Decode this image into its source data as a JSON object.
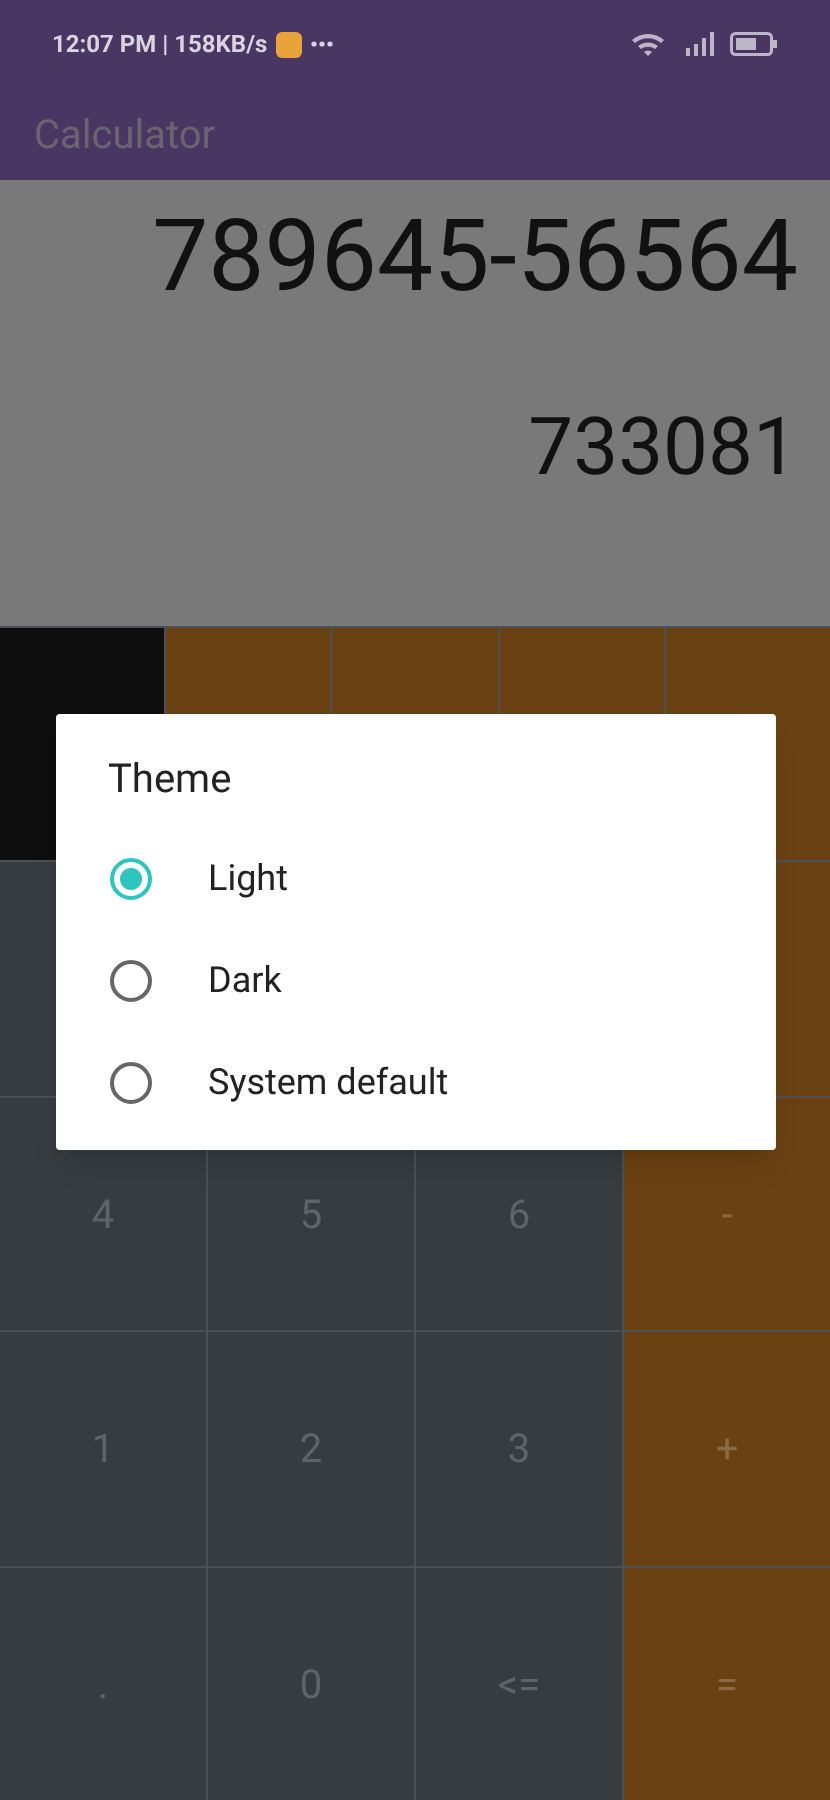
{
  "status_bar": {
    "time": "12:07 PM | 158KB/s"
  },
  "app_bar": {
    "title": "Calculator"
  },
  "display": {
    "expression": "789645-56564",
    "result": "733081"
  },
  "keypad": {
    "rows": [
      [
        {
          "kind": "function"
        },
        {
          "kind": "operator"
        },
        {
          "kind": "operator"
        },
        {
          "kind": "operator"
        },
        {
          "kind": "operator"
        }
      ],
      [
        {
          "kind": "digit"
        },
        {
          "kind": "digit"
        },
        {
          "kind": "digit"
        },
        {
          "kind": "operator"
        }
      ],
      [
        {
          "kind": "digit",
          "label": "4"
        },
        {
          "kind": "digit",
          "label": "5"
        },
        {
          "kind": "digit",
          "label": "6"
        },
        {
          "kind": "operator",
          "label": "-"
        }
      ],
      [
        {
          "kind": "digit",
          "label": "1"
        },
        {
          "kind": "digit",
          "label": "2"
        },
        {
          "kind": "digit",
          "label": "3"
        },
        {
          "kind": "operator",
          "label": "+"
        }
      ],
      [
        {
          "kind": "digit",
          "label": "."
        },
        {
          "kind": "digit",
          "label": "0"
        },
        {
          "kind": "digit",
          "label": "<="
        },
        {
          "kind": "operator",
          "label": "="
        }
      ]
    ]
  },
  "dialog": {
    "title": "Theme",
    "options": [
      {
        "label": "Light",
        "selected": true
      },
      {
        "label": "Dark",
        "selected": false
      },
      {
        "label": "System default",
        "selected": false
      }
    ]
  }
}
